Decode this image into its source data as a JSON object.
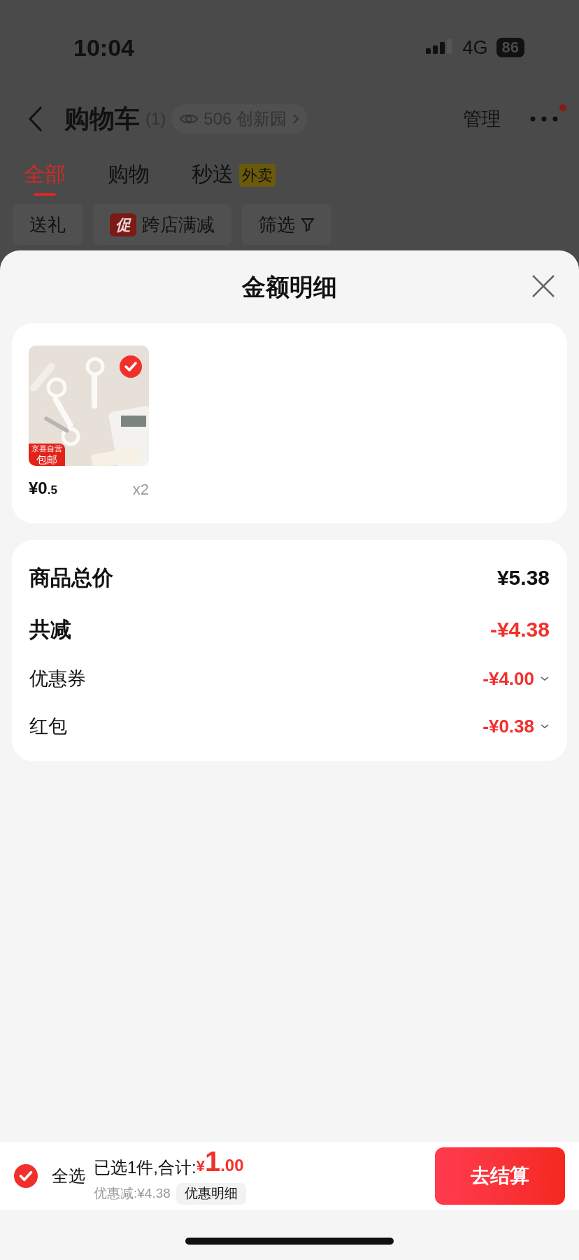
{
  "status_bar": {
    "time": "10:04",
    "network": "4G",
    "battery": "86"
  },
  "header": {
    "title": "购物车",
    "count": "(1)",
    "location": "506 创新园",
    "manage": "管理",
    "has_notification": true
  },
  "tabs": [
    {
      "label": "全部",
      "selected": true
    },
    {
      "label": "购物",
      "selected": false
    },
    {
      "label": "秒送",
      "badge": "外卖",
      "selected": false
    }
  ],
  "filters": [
    {
      "label": "送礼"
    },
    {
      "label": "跨店满减",
      "tag": "促"
    },
    {
      "label": "筛选",
      "kind": "filter"
    }
  ],
  "sheet": {
    "title": "金额明细",
    "items": [
      {
        "kind": "picture",
        "checked": true,
        "badge_top": "京喜自营",
        "badge_bottom": "包邮",
        "price_integer": "¥0",
        "price_decimal": ".5",
        "quantity": "x2"
      }
    ],
    "summary": [
      {
        "label": "商品总价",
        "value": "¥5.38",
        "kind": "total"
      },
      {
        "label": "共减",
        "value": "-¥4.38",
        "kind": "discount_total"
      },
      {
        "label": "优惠券",
        "value": "-¥4.00",
        "kind": "discount"
      },
      {
        "label": "红包",
        "value": "-¥0.38",
        "kind": "discount"
      }
    ]
  },
  "bottom_bar": {
    "select_all_checked": true,
    "select_all": "全选",
    "selected_text": "已选1件,合计:",
    "total_currency": "¥",
    "total_integer": "1",
    "total_decimal": ".00",
    "discount_text": "优惠减:¥4.38",
    "detail_button": "优惠明细",
    "checkout": "去结算"
  }
}
